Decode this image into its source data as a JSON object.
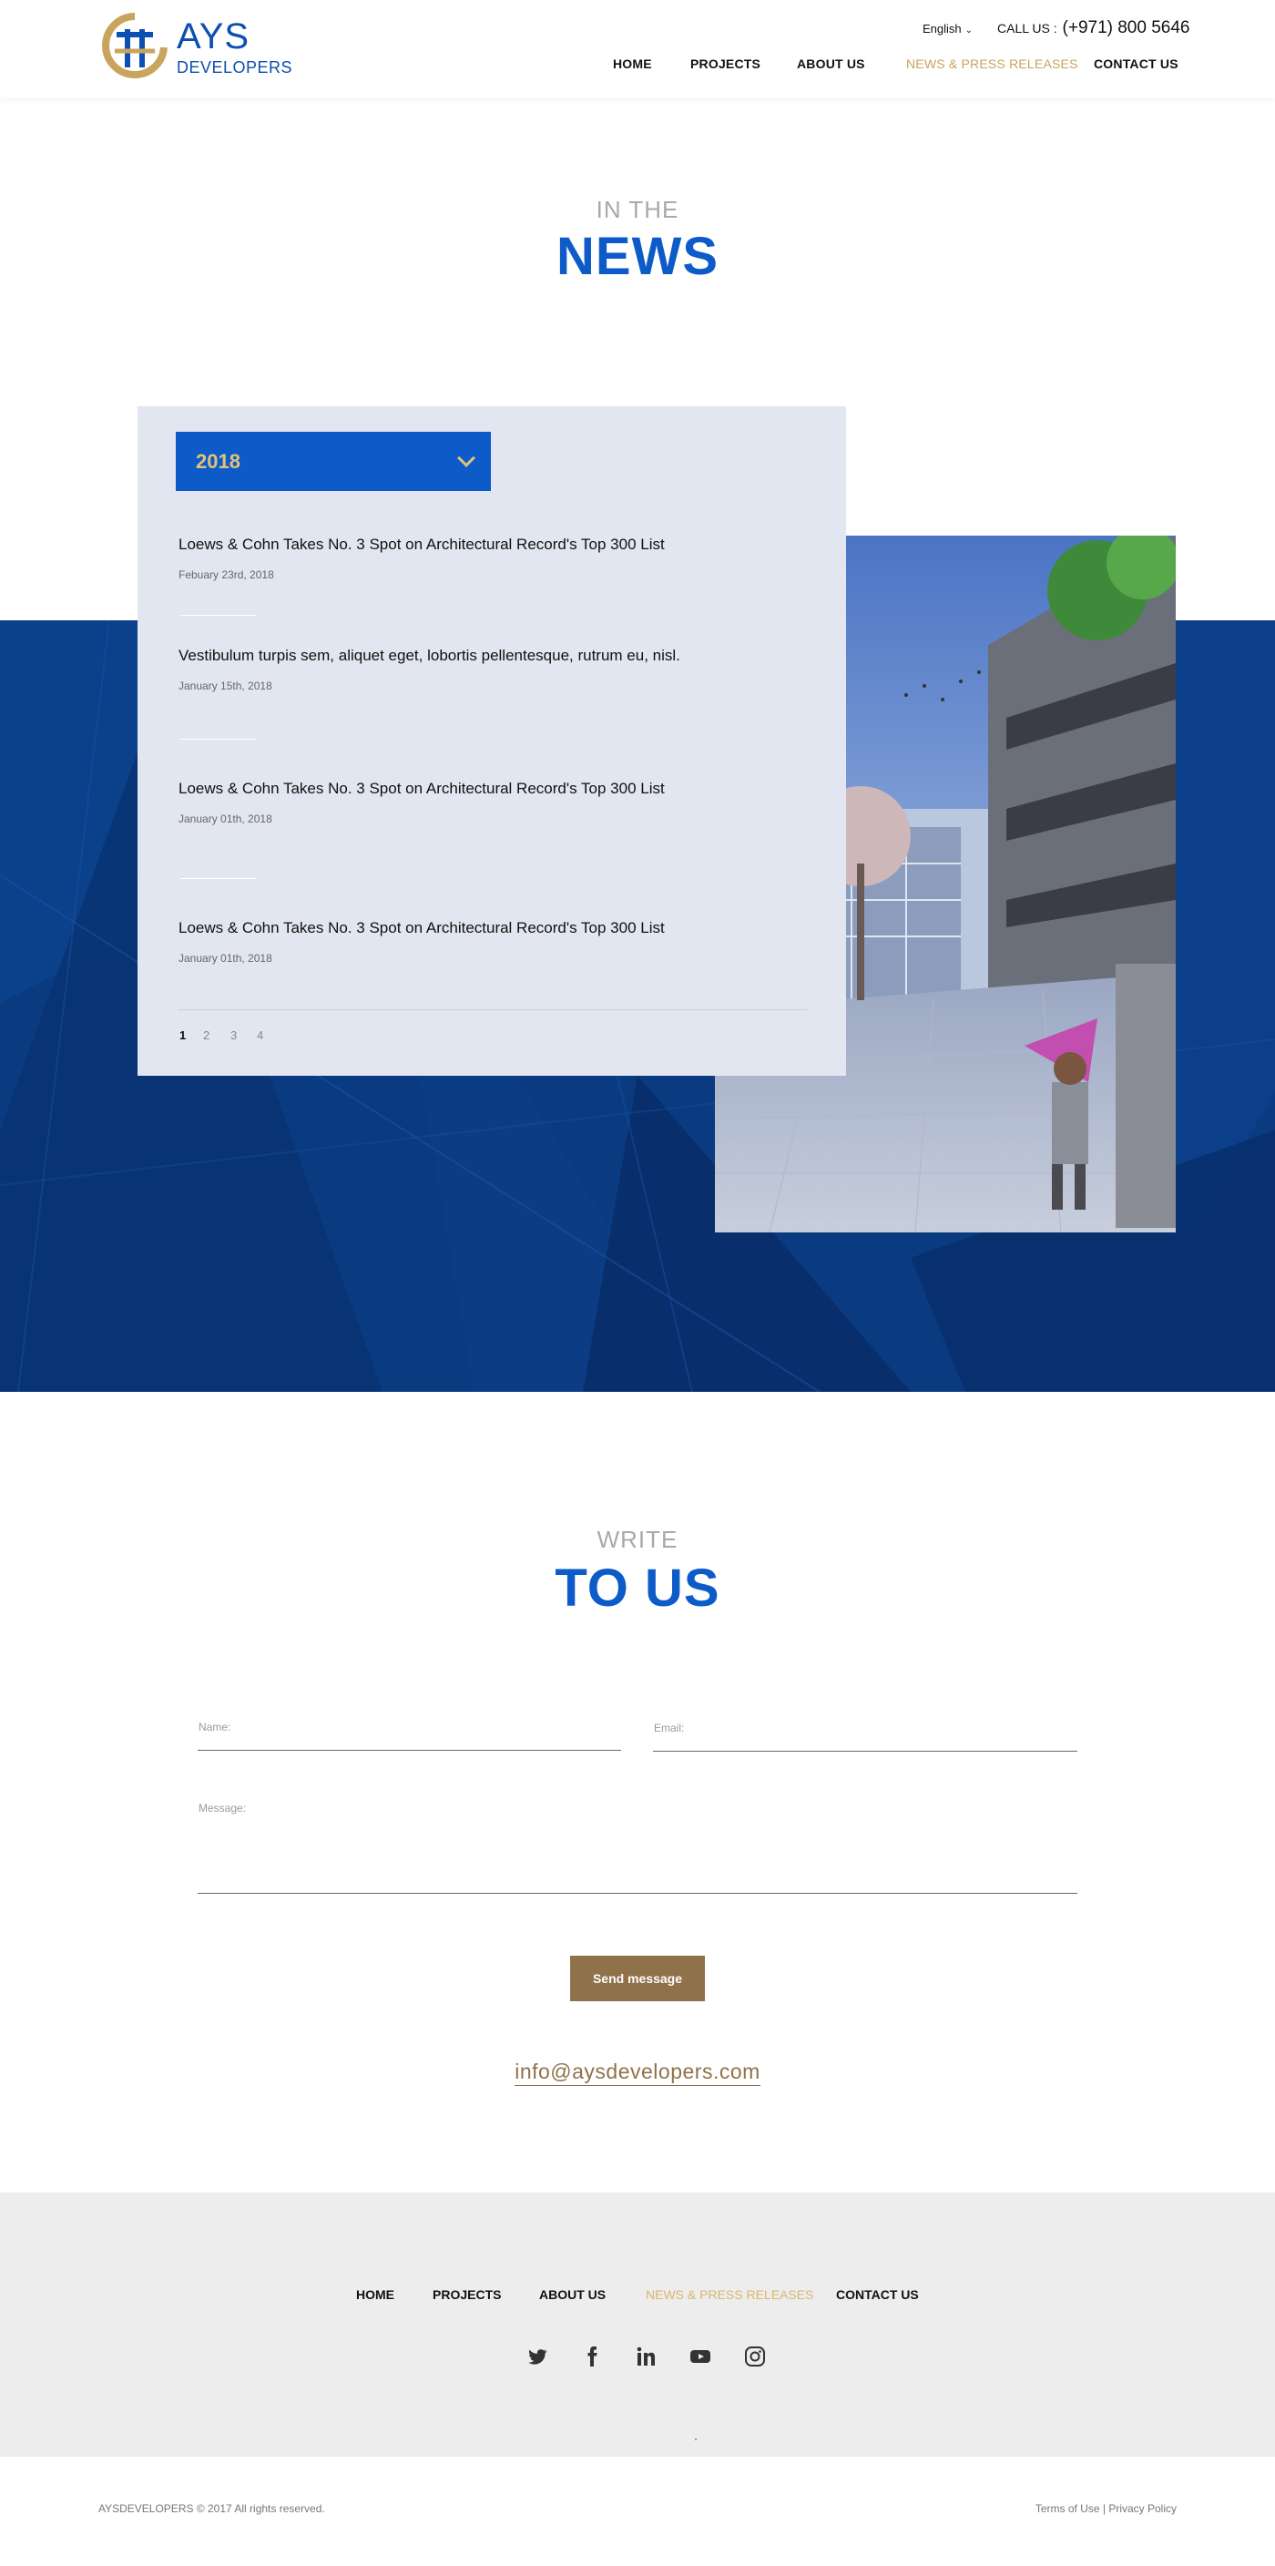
{
  "header": {
    "logo": {
      "line1": "AYS",
      "line2": "DEVELOPERS"
    },
    "language": "English",
    "call_label": "CALL US :",
    "call_number": "(+971)  800 5646",
    "nav": [
      "HOME",
      "PROJECTS",
      "ABOUT US",
      "NEWS & PRESS RELEASES",
      "CONTACT US"
    ],
    "active_nav": "NEWS & PRESS RELEASES"
  },
  "news_section": {
    "small_title": "IN THE",
    "big_title": "NEWS",
    "year_selected": "2018",
    "items": [
      {
        "title": "Loews & Cohn Takes No. 3 Spot on Architectural Record's Top 300 List",
        "date": "Febuary 23rd, 2018"
      },
      {
        "title": "Vestibulum turpis sem, aliquet eget, lobortis pellentesque, rutrum eu, nisl.",
        "date": "January 15th, 2018"
      },
      {
        "title": "Loews & Cohn Takes No. 3 Spot on Architectural Record's Top 300 List",
        "date": "January  01th, 2018"
      },
      {
        "title": "Loews & Cohn Takes No. 3 Spot on Architectural Record's Top 300 List",
        "date": "January  01th, 2018"
      }
    ],
    "pages": [
      "1",
      "2",
      "3",
      "4"
    ],
    "current_page": "1"
  },
  "write_section": {
    "small_title": "WRITE",
    "big_title": "TO US",
    "name_label": "Name:",
    "email_label": "Email:",
    "message_label": "Message:",
    "send_label": "Send message",
    "contact_email": "info@aysdevelopers.com"
  },
  "footer": {
    "nav": [
      "HOME",
      "PROJECTS",
      "ABOUT US",
      "NEWS & PRESS RELEASES",
      "CONTACT US"
    ],
    "social": [
      "twitter-icon",
      "facebook-icon",
      "linkedin-icon",
      "youtube-icon",
      "instagram-icon"
    ],
    "copyright": "AYSDEVELOPERS © 2017 All rights reserved.",
    "terms": "Terms of Use",
    "separator": "|",
    "privacy": "Privacy Policy"
  },
  "colors": {
    "brand_blue": "#0d5bc8",
    "gold": "#c9a45c",
    "band_blue": "#0a3a80",
    "button_brown": "#8f724a"
  }
}
